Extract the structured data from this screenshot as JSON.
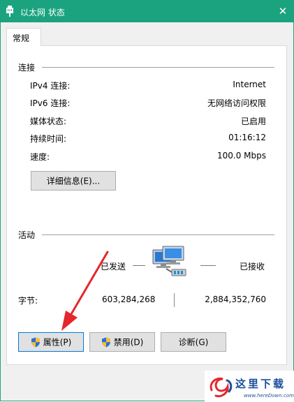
{
  "window": {
    "title": "以太网 状态",
    "close": "✕"
  },
  "tab": {
    "label": "常规"
  },
  "connection": {
    "title": "连接",
    "rows": [
      {
        "label": "IPv4 连接:",
        "value": "Internet"
      },
      {
        "label": "IPv6 连接:",
        "value": "无网络访问权限"
      },
      {
        "label": "媒体状态:",
        "value": "已启用"
      },
      {
        "label": "持续时间:",
        "value": "01:16:12"
      },
      {
        "label": "速度:",
        "value": "100.0 Mbps"
      }
    ],
    "details_button": "详细信息(E)..."
  },
  "activity": {
    "title": "活动",
    "sent_label": "已发送",
    "received_label": "已接收",
    "bytes_label": "字节:",
    "bytes_sent": "603,284,268",
    "bytes_received": "2,884,352,760"
  },
  "buttons": {
    "properties": "属性(P)",
    "disable": "禁用(D)",
    "diagnose": "诊断(G)"
  },
  "watermark": {
    "text_cn": "这里下载",
    "text_url": "www.hereDown.com"
  },
  "colors": {
    "titlebar": "#1ba37f",
    "arrow": "#e5272d",
    "focus_border": "#0078d7"
  }
}
